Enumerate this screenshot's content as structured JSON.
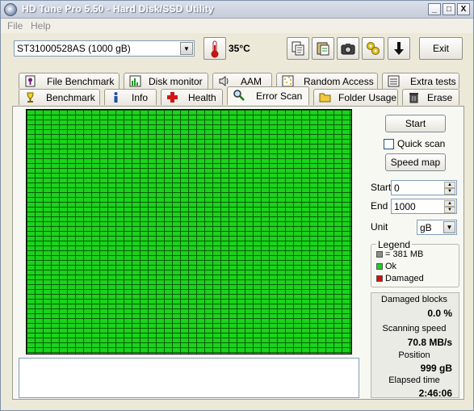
{
  "window": {
    "title": "HD Tune Pro 5.50 - Hard Disk/SSD Utility",
    "controls": {
      "minimize": "_",
      "maximize": "□",
      "close": "X"
    }
  },
  "menu": {
    "file": "File",
    "help": "Help"
  },
  "toolbar": {
    "drive": "ST31000528AS (1000 gB)",
    "temperature": "35°C",
    "icons": [
      "copy-icon",
      "paste-icon",
      "camera-icon",
      "options-icon",
      "download-icon"
    ],
    "exit_label": "Exit"
  },
  "tabs": {
    "row1": [
      {
        "label": "File Benchmark",
        "icon": "file-benchmark-icon"
      },
      {
        "label": "Disk monitor",
        "icon": "disk-monitor-icon"
      },
      {
        "label": "AAM",
        "icon": "speaker-icon"
      },
      {
        "label": "Random Access",
        "icon": "random-access-icon"
      },
      {
        "label": "Extra tests",
        "icon": "extra-tests-icon"
      }
    ],
    "row2": [
      {
        "label": "Benchmark",
        "icon": "benchmark-icon"
      },
      {
        "label": "Info",
        "icon": "info-icon"
      },
      {
        "label": "Health",
        "icon": "health-icon"
      },
      {
        "label": "Error Scan",
        "icon": "magnifier-icon"
      },
      {
        "label": "Folder Usage",
        "icon": "folder-icon"
      },
      {
        "label": "Erase",
        "icon": "trash-icon"
      }
    ],
    "active": "Error Scan"
  },
  "scan": {
    "start_button": "Start",
    "quick_scan_label": "Quick scan",
    "quick_scan_checked": false,
    "speed_map_button": "Speed map",
    "start_label": "Start",
    "start_value": "0",
    "end_label": "End",
    "end_value": "1000",
    "unit_label": "Unit",
    "unit_value": "gB",
    "block_status": "all-ok"
  },
  "legend": {
    "title": "Legend",
    "items": [
      {
        "label": "= 381 MB",
        "color": "#8c8c8c"
      },
      {
        "label": "Ok",
        "color": "#1bd31b"
      },
      {
        "label": "Damaged",
        "color": "#d01010"
      }
    ]
  },
  "stats": {
    "damaged_blocks_label": "Damaged blocks",
    "damaged_blocks_value": "0.0 %",
    "scanning_speed_label": "Scanning speed",
    "scanning_speed_value": "70.8 MB/s",
    "position_label": "Position",
    "position_value": "999 gB",
    "elapsed_label": "Elapsed time",
    "elapsed_value": "2:46:06"
  },
  "colors": {
    "ok_block": "#1bd31b",
    "grid_line": "#0a5b0a",
    "damaged": "#d01010"
  }
}
